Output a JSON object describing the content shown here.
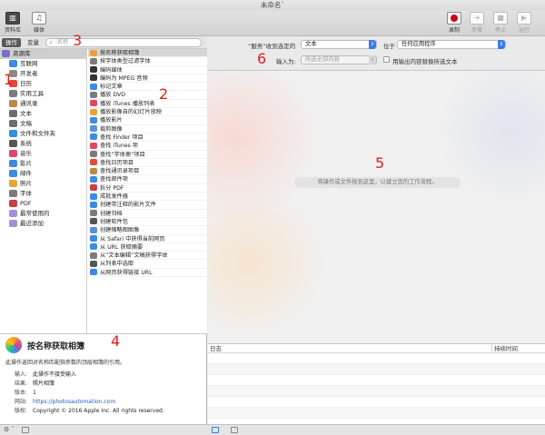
{
  "window": {
    "title": "未命名"
  },
  "toolbar": {
    "library": "资料库",
    "media": "媒体",
    "record": "录制",
    "step": "步骤",
    "stop": "停止",
    "run": "运行"
  },
  "left_header": {
    "tab_actions": "操作",
    "tab_variables": "变量",
    "search_placeholder": "名称"
  },
  "library_items": [
    {
      "label": "资源库",
      "icon": "library-icon",
      "color": "#7a6fc8"
    },
    {
      "label": "互联网",
      "icon": "globe-icon",
      "color": "#3b8be0"
    },
    {
      "label": "开发者",
      "icon": "hammer-icon",
      "color": "#8a8a8a"
    },
    {
      "label": "日历",
      "icon": "calendar-icon",
      "color": "#e24a3a"
    },
    {
      "label": "实用工具",
      "icon": "tools-icon",
      "color": "#7b7b7b"
    },
    {
      "label": "通讯录",
      "icon": "contacts-icon",
      "color": "#b98a4a"
    },
    {
      "label": "文本",
      "icon": "text-icon",
      "color": "#6d6d6d"
    },
    {
      "label": "文稿",
      "icon": "document-icon",
      "color": "#6d6d6d"
    },
    {
      "label": "文件和文件夹",
      "icon": "finder-icon",
      "color": "#3b8be0"
    },
    {
      "label": "系统",
      "icon": "system-icon",
      "color": "#555555"
    },
    {
      "label": "音乐",
      "icon": "music-icon",
      "color": "#e0456a"
    },
    {
      "label": "影片",
      "icon": "movie-icon",
      "color": "#3b8be0"
    },
    {
      "label": "邮件",
      "icon": "mail-icon",
      "color": "#3b8be0"
    },
    {
      "label": "照片",
      "icon": "photo-icon",
      "color": "#e8a33a"
    },
    {
      "label": "字体",
      "icon": "font-icon",
      "color": "#7b7b7b"
    },
    {
      "label": "PDF",
      "icon": "pdf-icon",
      "color": "#c94040"
    },
    {
      "label": "最常使用的",
      "icon": "folder-icon",
      "color": "#a78ed8"
    },
    {
      "label": "最近添加",
      "icon": "folder-icon",
      "color": "#a78ed8"
    }
  ],
  "actions": [
    {
      "label": "按名称获取相簿",
      "icon": "photos-icon",
      "color": "#e8a33a"
    },
    {
      "label": "按字体类型过滤字体",
      "icon": "font-icon",
      "color": "#7b7b7b"
    },
    {
      "label": "编码媒体",
      "icon": "media-icon",
      "color": "#333333"
    },
    {
      "label": "编码为 MPEG 音频",
      "icon": "audio-icon",
      "color": "#333333"
    },
    {
      "label": "标记文章",
      "icon": "article-icon",
      "color": "#3b8be0"
    },
    {
      "label": "播放 DVD",
      "icon": "dvd-icon",
      "color": "#7b7b7b"
    },
    {
      "label": "播放 iTunes 播放列表",
      "icon": "itunes-icon",
      "color": "#e0456a"
    },
    {
      "label": "播放影像自的幻灯片放映",
      "icon": "slideshow-icon",
      "color": "#e8a33a"
    },
    {
      "label": "播放影片",
      "icon": "movie-icon",
      "color": "#3b8be0"
    },
    {
      "label": "裁剪图像",
      "icon": "crop-icon",
      "color": "#5b8fd6"
    },
    {
      "label": "查找 Finder 项目",
      "icon": "finder-icon",
      "color": "#3b8be0"
    },
    {
      "label": "查找 iTunes 项",
      "icon": "itunes-icon",
      "color": "#e0456a"
    },
    {
      "label": "查找“字体册”项目",
      "icon": "font-icon",
      "color": "#7b7b7b"
    },
    {
      "label": "查找日历项目",
      "icon": "calendar-icon",
      "color": "#e24a3a"
    },
    {
      "label": "查找通讯录项目",
      "icon": "contacts-icon",
      "color": "#b98a4a"
    },
    {
      "label": "查找邮件项",
      "icon": "mail-icon",
      "color": "#3b8be0"
    },
    {
      "label": "拆分 PDF",
      "icon": "pdf-icon",
      "color": "#c94040"
    },
    {
      "label": "成批发件器",
      "icon": "mail-icon",
      "color": "#3b8be0"
    },
    {
      "label": "创建带注释的影片文件",
      "icon": "movie-icon",
      "color": "#3b8be0"
    },
    {
      "label": "创建归档",
      "icon": "archive-icon",
      "color": "#7b7b7b"
    },
    {
      "label": "创建软件包",
      "icon": "package-icon",
      "color": "#555555"
    },
    {
      "label": "创建缩略图图像",
      "icon": "thumbnail-icon",
      "color": "#5b8fd6"
    },
    {
      "label": "从 Safari 中获得当前网页",
      "icon": "safari-icon",
      "color": "#3b8be0"
    },
    {
      "label": "从 URL 获取摘要",
      "icon": "safari-icon",
      "color": "#3b8be0"
    },
    {
      "label": "从“文本编辑”文稿获得字体",
      "icon": "textedit-icon",
      "color": "#7b7b7b"
    },
    {
      "label": "从列表中选取",
      "icon": "list-icon",
      "color": "#555555"
    },
    {
      "label": "从网页获得链接 URL",
      "icon": "safari-icon",
      "color": "#3b8be0"
    }
  ],
  "description": {
    "title": "按名称获取相簿",
    "text": "此操作返回对名称匹配指参数的顶层相簿的引用。",
    "input_key": "输入:",
    "input_val": "此操作不接受输入",
    "result_key": "结果:",
    "result_val": "照片相簿",
    "version_key": "版本:",
    "version_val": "1",
    "site_key": "网站:",
    "site_val": "https://photosautomation.com",
    "copyright_key": "版权:",
    "copyright_val": "Copyright © 2016 Apple Inc. All rights reserved."
  },
  "service": {
    "received_label": "“服务”收到选定的",
    "received_value": "文本",
    "in_label": "位于",
    "in_value": "任何应用程序",
    "input_label": "输入为:",
    "input_value": "所选全部内容",
    "replace_label": "用输出内容替换所选文本"
  },
  "workflow": {
    "hint": "将操作或文件拖到这里，以建立您的工作流程。"
  },
  "log": {
    "col_log": "日志",
    "col_time": "持续时间"
  },
  "annotations": [
    "1",
    "2",
    "3",
    "4",
    "5",
    "6"
  ]
}
